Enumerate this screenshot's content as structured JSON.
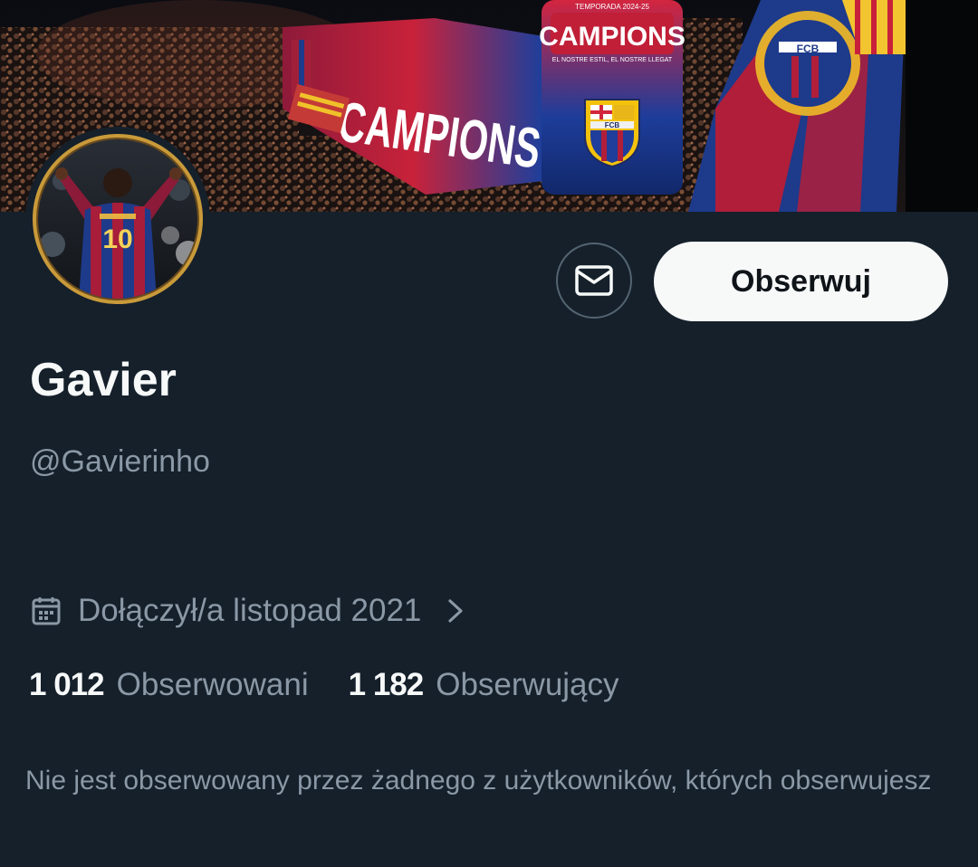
{
  "banner": {
    "description_icon": "team-celebration-banner",
    "bus_text": "CAMPIONS",
    "bus_side_text": "CAMPIONS",
    "bus_small_text": "TEMPORADA 2024-25",
    "bus_sub_text": "EL NOSTRE ESTIL, EL NOSTRE LLEGAT",
    "crest_text": "FCB"
  },
  "profile": {
    "avatar_icon": "profile-avatar",
    "avatar_shirt_number": "10",
    "display_name": "Gavier",
    "handle": "@Gavierinho",
    "joined_icon": "calendar-icon",
    "joined_text": "Dołączył/a listopad 2021",
    "following_count": "1 012",
    "following_label": "Obserwowani",
    "followers_count": "1 182",
    "followers_label": "Obserwujący",
    "mutuals_note": "Nie jest obserwowany przez żadnego z użytkowników, których obserwujesz"
  },
  "actions": {
    "message_icon": "envelope-icon",
    "follow_label": "Obserwuj"
  },
  "colors": {
    "background": "#15202b",
    "primary_text": "#f7f9f9",
    "secondary_text": "#8b98a5",
    "border": "#536471",
    "follow_bg": "#f7f9f9",
    "avatar_ring": "#c99a3a"
  }
}
